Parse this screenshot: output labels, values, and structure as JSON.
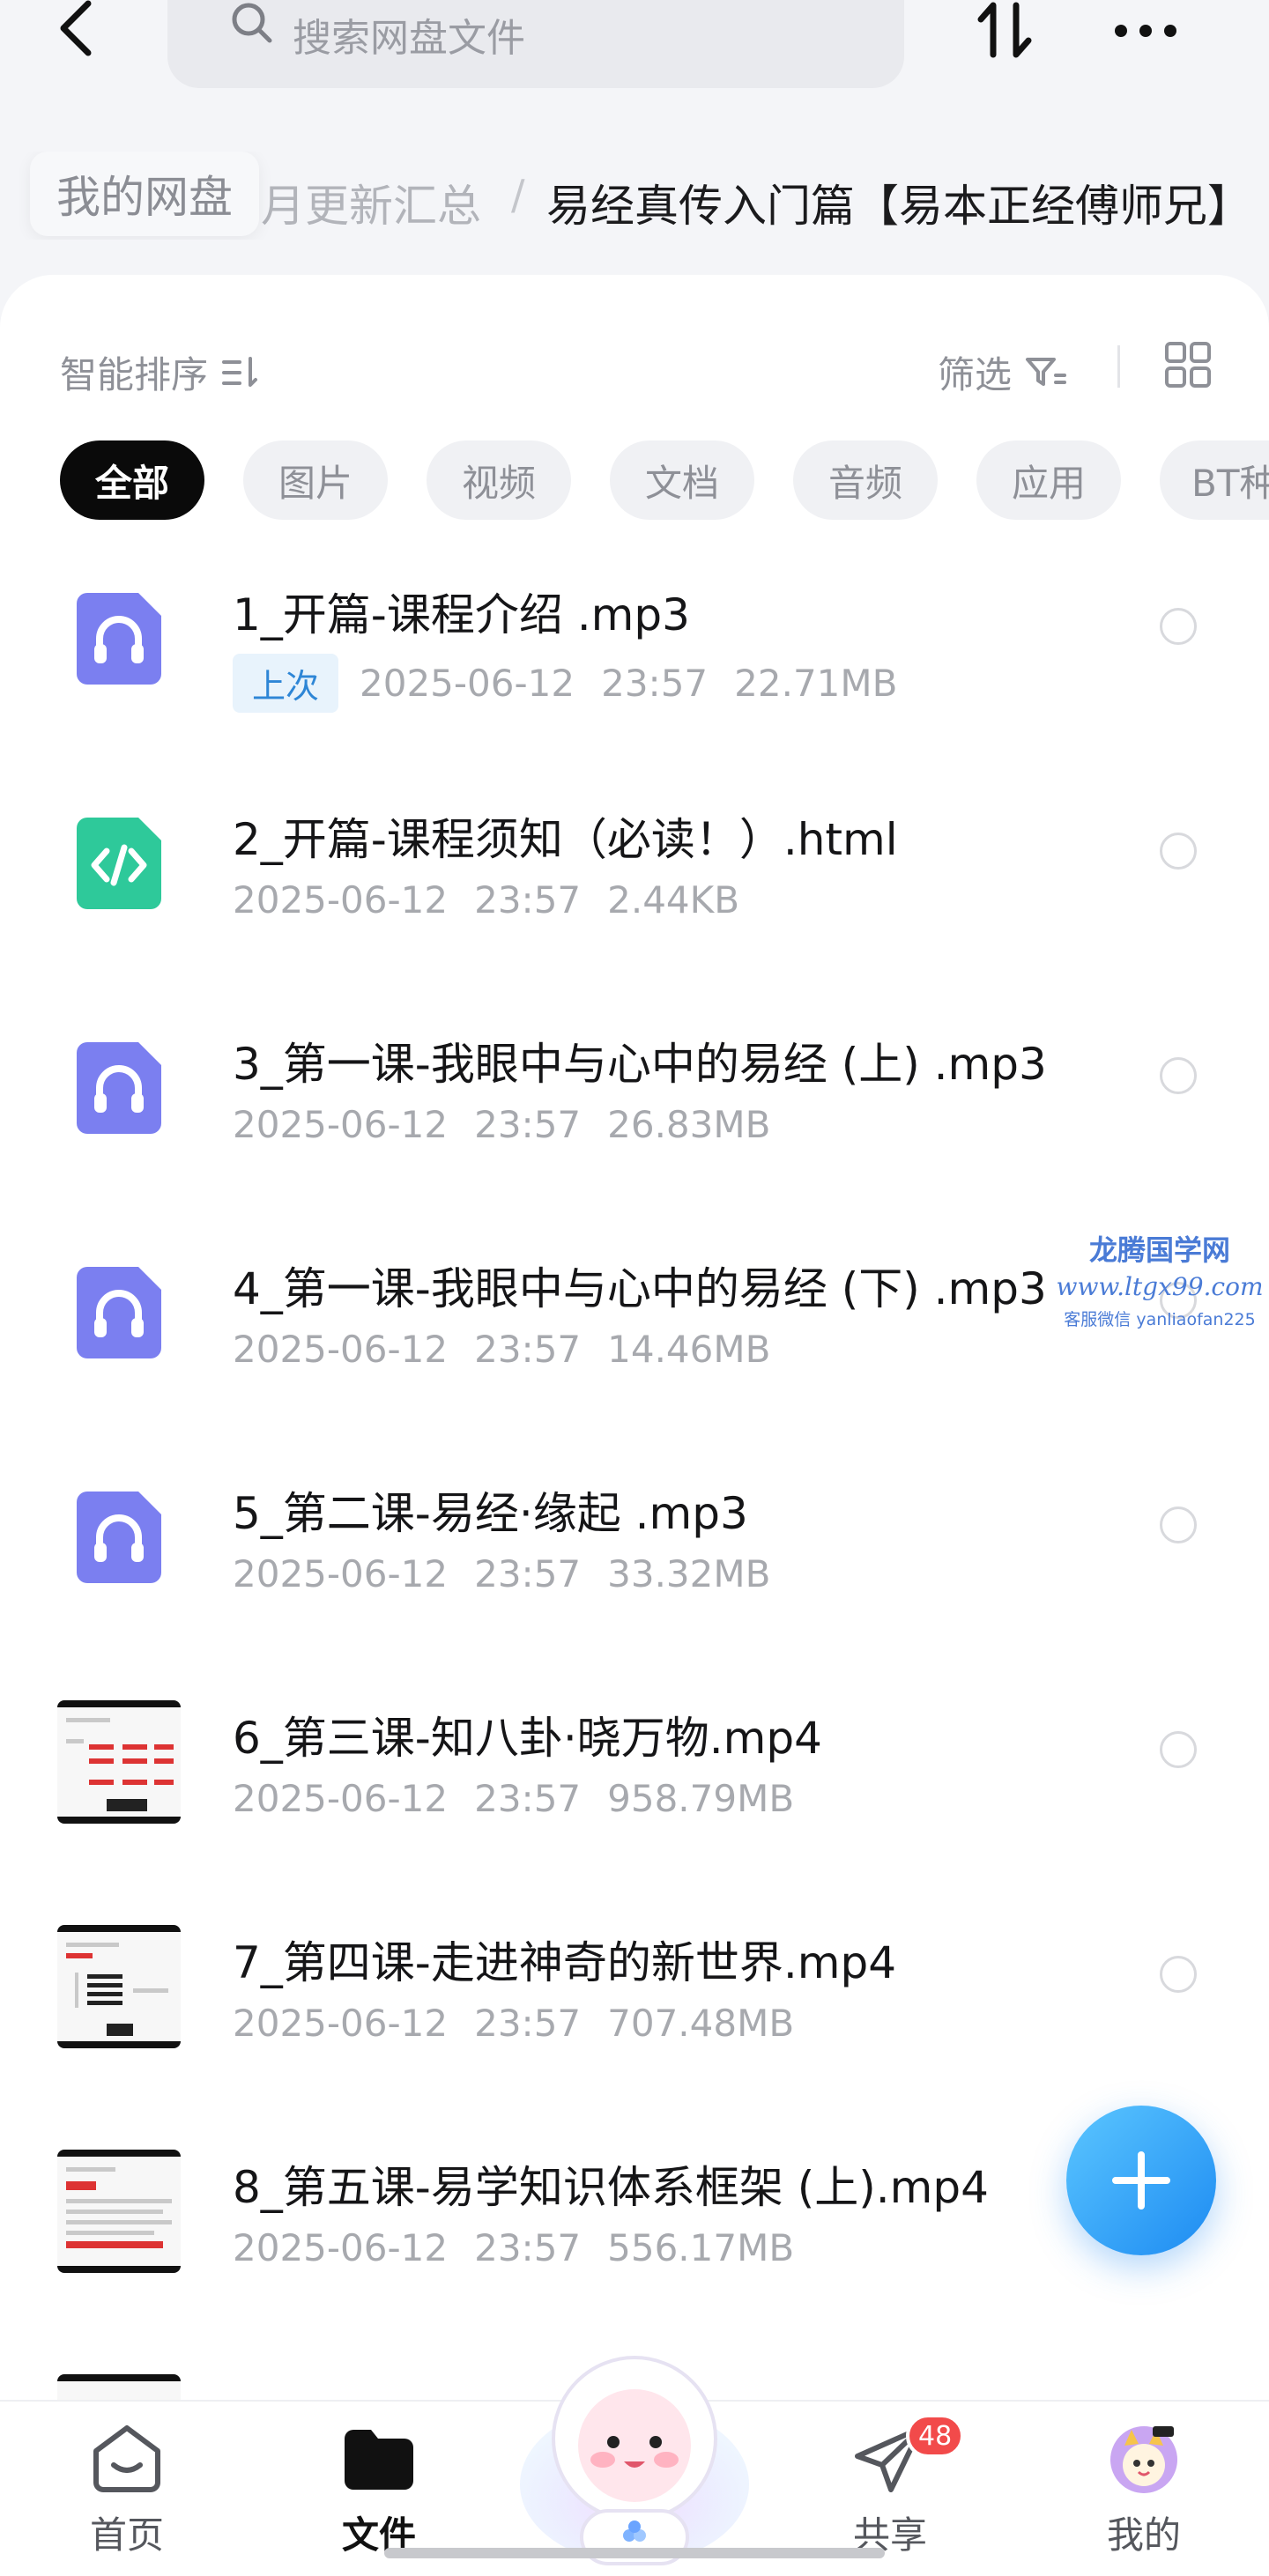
{
  "header": {
    "search_placeholder": "搜索网盘文件"
  },
  "breadcrumb": {
    "root": "我的网盘",
    "middle": "月更新汇总",
    "separator": "/",
    "current": "易经真传入门篇【易本正经傅师兄】"
  },
  "toolbar": {
    "smart_sort": "智能排序",
    "filter": "筛选"
  },
  "tabs": [
    "全部",
    "图片",
    "视频",
    "文档",
    "音频",
    "应用",
    "BT种"
  ],
  "files": [
    {
      "name": "1_开篇-课程介绍 .mp3",
      "tag": "上次",
      "date": "2025-06-12",
      "time": "23:57",
      "size": "22.71MB",
      "type": "audio"
    },
    {
      "name": "2_开篇-课程须知（必读！）.html",
      "tag": "",
      "date": "2025-06-12",
      "time": "23:57",
      "size": "2.44KB",
      "type": "html"
    },
    {
      "name": "3_第一课-我眼中与心中的易经 (上) .mp3",
      "tag": "",
      "date": "2025-06-12",
      "time": "23:57",
      "size": "26.83MB",
      "type": "audio"
    },
    {
      "name": "4_第一课-我眼中与心中的易经 (下) .mp3",
      "tag": "",
      "date": "2025-06-12",
      "time": "23:57",
      "size": "14.46MB",
      "type": "audio"
    },
    {
      "name": "5_第二课-易经·缘起 .mp3",
      "tag": "",
      "date": "2025-06-12",
      "time": "23:57",
      "size": "33.32MB",
      "type": "audio"
    },
    {
      "name": "6_第三课-知八卦·晓万物.mp4",
      "tag": "",
      "date": "2025-06-12",
      "time": "23:57",
      "size": "958.79MB",
      "type": "video"
    },
    {
      "name": "7_第四课-走进神奇的新世界.mp4",
      "tag": "",
      "date": "2025-06-12",
      "time": "23:57",
      "size": "707.48MB",
      "type": "video"
    },
    {
      "name": "8_第五课-易学知识体系框架 (上).mp4",
      "tag": "",
      "date": "2025-06-12",
      "time": "23:57",
      "size": "556.17MB",
      "type": "video"
    }
  ],
  "watermark": {
    "line1": "龙腾国学网",
    "line2": "www.ltgx99.com",
    "line3": "客服微信 yanliaofan225"
  },
  "nav": {
    "home": "首页",
    "files": "文件",
    "share": "共享",
    "share_badge": "48",
    "me": "我的"
  },
  "colors": {
    "accent": "#1d8bf2",
    "audio_icon": "#7b7ff0",
    "html_icon": "#2ec99a",
    "badge": "#f24a4a"
  },
  "icons": {
    "back": "chevron-left-icon",
    "search": "search-icon",
    "sort": "sort-arrows-icon",
    "more": "more-dots-icon",
    "filter": "filter-icon",
    "grid": "grid-view-icon",
    "fab": "plus-icon"
  }
}
